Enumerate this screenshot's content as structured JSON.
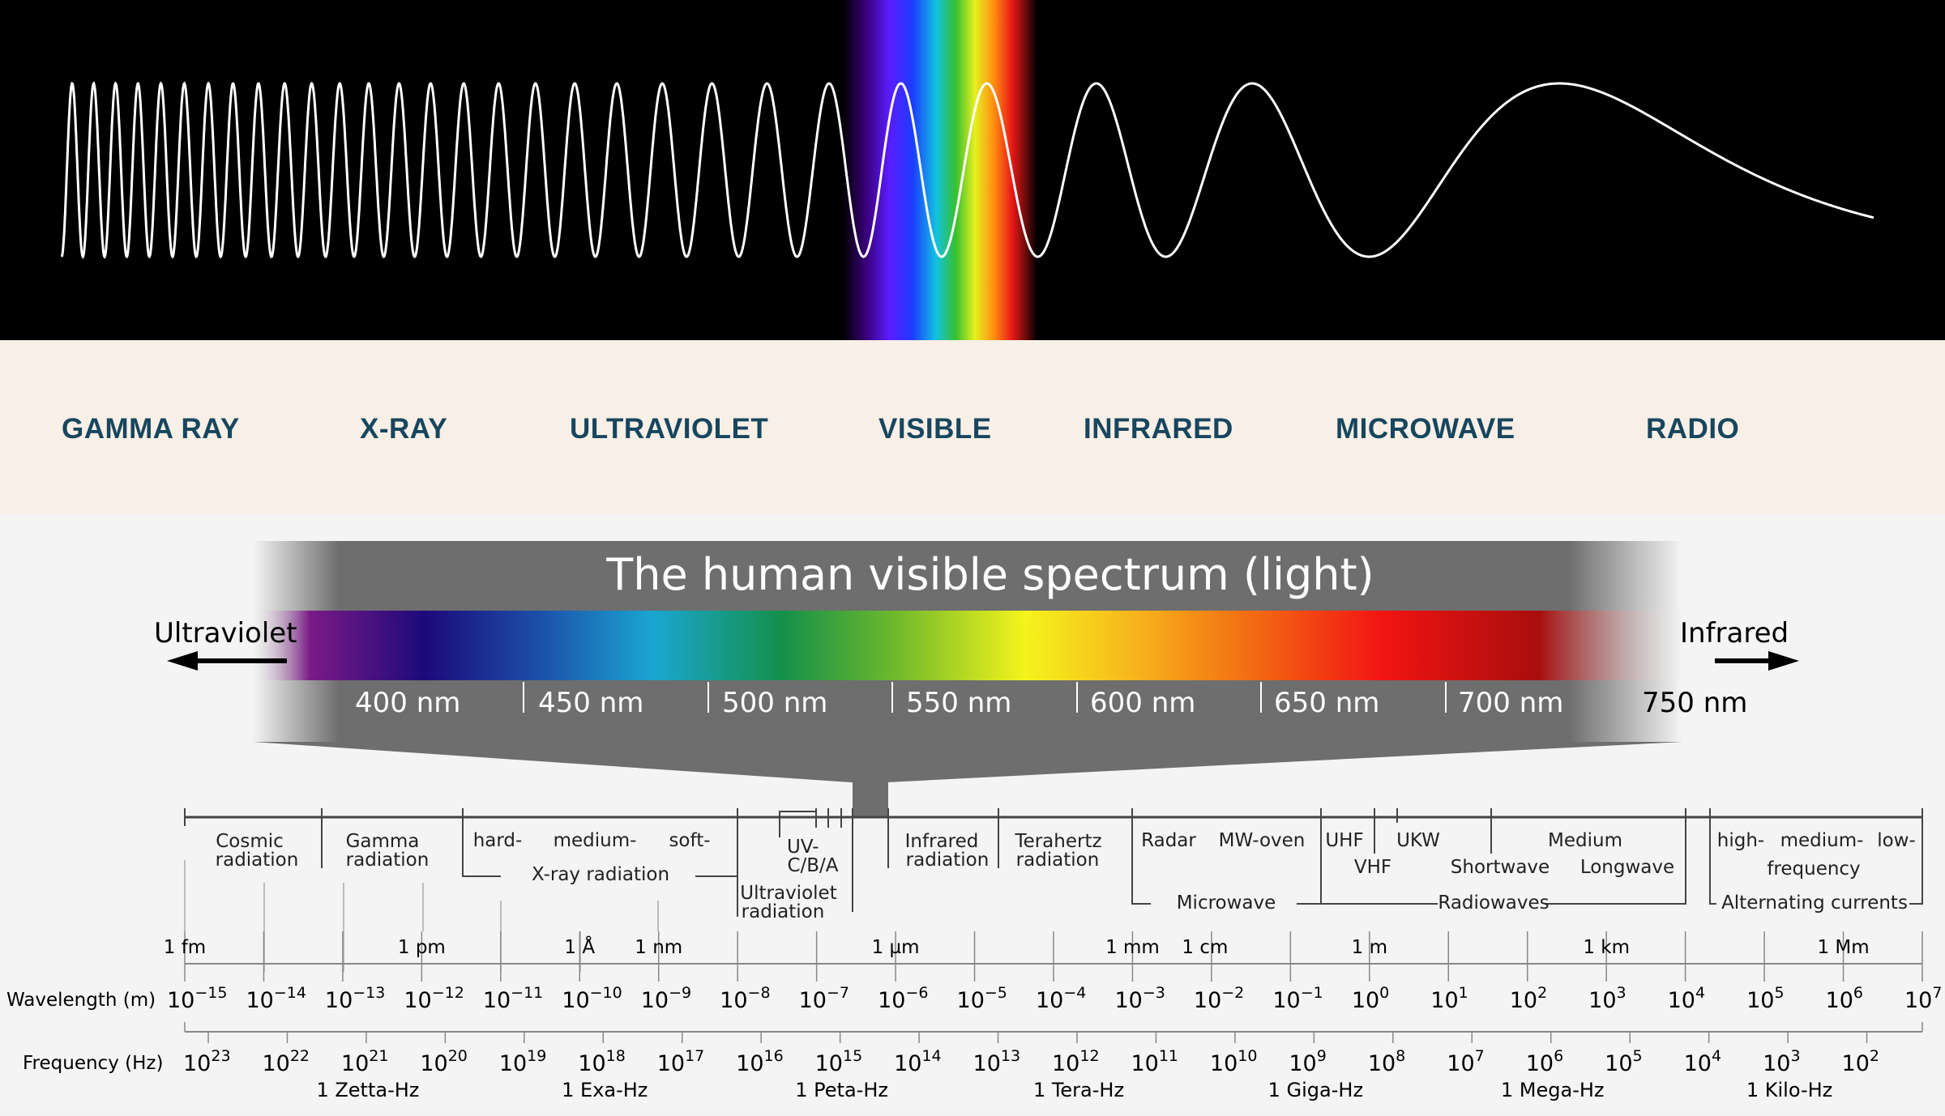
{
  "bands": [
    "GAMMA RAY",
    "X-RAY",
    "ULTRAVIOLET",
    "VISIBLE",
    "INFRARED",
    "MICROWAVE",
    "RADIO"
  ],
  "visible_spectrum": {
    "title": "The human visible spectrum (light)",
    "left_label": "Ultraviolet",
    "right_label": "Infrared",
    "ticks": [
      "400 nm",
      "450 nm",
      "500 nm",
      "550 nm",
      "600 nm",
      "650 nm",
      "700 nm",
      "750 nm"
    ]
  },
  "regions": {
    "cosmic": [
      "Cosmic",
      "radiation"
    ],
    "gamma": [
      "Gamma",
      "radiation"
    ],
    "xray_sub": [
      "hard-",
      "medium-",
      "soft-"
    ],
    "xray": "X-ray radiation",
    "uv_sub": [
      "UV-",
      "C/B/A"
    ],
    "uv": [
      "Ultraviolet",
      "radiation"
    ],
    "infrared": [
      "Infrared",
      "radiation"
    ],
    "terahertz": [
      "Terahertz",
      "radiation"
    ],
    "radar": "Radar",
    "mw_oven": "MW-oven",
    "microwave": "Microwave",
    "uhf": "UHF",
    "vhf": "VHF",
    "ukw": "UKW",
    "shortwave": "Shortwave",
    "medium": "Medium",
    "longwave": "Longwave",
    "radiowaves": "Radiowaves",
    "ac_sub": [
      "high-",
      "medium-",
      "low-"
    ],
    "frequency": "frequency",
    "alternating": "Alternating currents"
  },
  "wavelength": {
    "label": "Wavelength (m)",
    "unit_labels": [
      "1 fm",
      "1 pm",
      "1 Å",
      "1 nm",
      "1 µm",
      "1 mm",
      "1 cm",
      "1 m",
      "1 km",
      "1 Mm"
    ],
    "exponents": [
      "−15",
      "−14",
      "−13",
      "−12",
      "−11",
      "−10",
      "−9",
      "−8",
      "−7",
      "−6",
      "−5",
      "−4",
      "−3",
      "−2",
      "−1",
      "0",
      "1",
      "2",
      "3",
      "4",
      "5",
      "6",
      "7"
    ]
  },
  "frequency": {
    "label": "Frequency (Hz)",
    "exponents": [
      "23",
      "22",
      "21",
      "20",
      "19",
      "18",
      "17",
      "16",
      "15",
      "14",
      "13",
      "12",
      "11",
      "10",
      "9",
      "8",
      "7",
      "6",
      "5",
      "4",
      "3",
      "2"
    ],
    "unit_labels": [
      "1 Zetta-Hz",
      "1 Exa-Hz",
      "1 Peta-Hz",
      "1 Tera-Hz",
      "1 Giga-Hz",
      "1 Mega-Hz",
      "1 Kilo-Hz"
    ]
  }
}
